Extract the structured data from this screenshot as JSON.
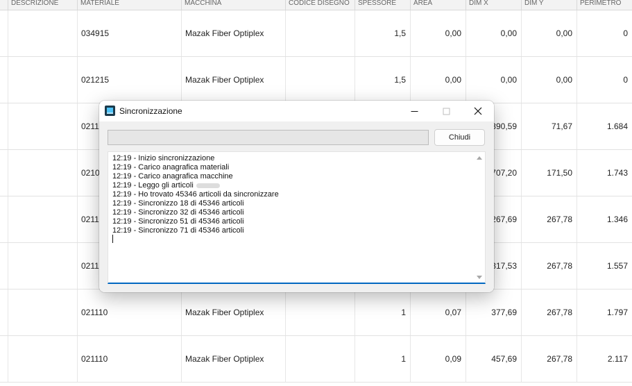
{
  "grid": {
    "headers": [
      "DESCRIZIONE",
      "MATERIALE",
      "MACCHINA",
      "CODICE DISEGNO",
      "SPESSORE",
      "AREA",
      "DIM X",
      "DIM Y",
      "PERIMETRO"
    ],
    "rows": [
      {
        "materiale": "034915",
        "macchina": "Mazak Fiber Optiplex",
        "spessore": "1,5",
        "area": "0,00",
        "dimx": "0,00",
        "dimy": "0,00",
        "perimetro": "0"
      },
      {
        "materiale": "021215",
        "macchina": "Mazak Fiber Optiplex",
        "spessore": "1,5",
        "area": "0,00",
        "dimx": "0,00",
        "dimy": "0,00",
        "perimetro": "0"
      },
      {
        "materiale": "02113",
        "macchina": "",
        "spessore": "",
        "area": "",
        "dimx": "390,59",
        "dimy": "71,67",
        "perimetro": "1.684"
      },
      {
        "materiale": "0210",
        "macchina": "",
        "spessore": "",
        "area": "",
        "dimx": "707,20",
        "dimy": "171,50",
        "perimetro": "1.743"
      },
      {
        "materiale": "0211",
        "macchina": "",
        "spessore": "",
        "area": "",
        "dimx": "267,69",
        "dimy": "267,78",
        "perimetro": "1.346"
      },
      {
        "materiale": "0211",
        "macchina": "",
        "spessore": "",
        "area": "",
        "dimx": "317,53",
        "dimy": "267,78",
        "perimetro": "1.557"
      },
      {
        "materiale": "021110",
        "macchina": "Mazak Fiber Optiplex",
        "spessore": "1",
        "area": "0,07",
        "dimx": "377,69",
        "dimy": "267,78",
        "perimetro": "1.797"
      },
      {
        "materiale": "021110",
        "macchina": "Mazak Fiber Optiplex",
        "spessore": "1",
        "area": "0,09",
        "dimx": "457,69",
        "dimy": "267,78",
        "perimetro": "2.117"
      }
    ]
  },
  "dialog": {
    "title": "Sincronizzazione",
    "app_icon": "app-icon",
    "close_button_label": "Chiudi",
    "progress": 0,
    "log_lines": [
      "12:19 - Inizio sincronizzazione",
      "12:19 - Carico anagrafica materiali",
      "12:19 - Carico anagrafica macchine",
      "12:19 - Leggo gli articoli",
      "12:19 - Ho trovato 45346 articoli da sincronizzare",
      "12:19 - Sincronizzo 18 di 45346 articoli",
      "12:19 - Sincronizzo 32 di 45346 articoli",
      "12:19 - Sincronizzo 51 di 45346 articoli",
      "12:19 - Sincronizzo 71 di 45346 articoli"
    ],
    "accent_color": "#0067c0"
  }
}
